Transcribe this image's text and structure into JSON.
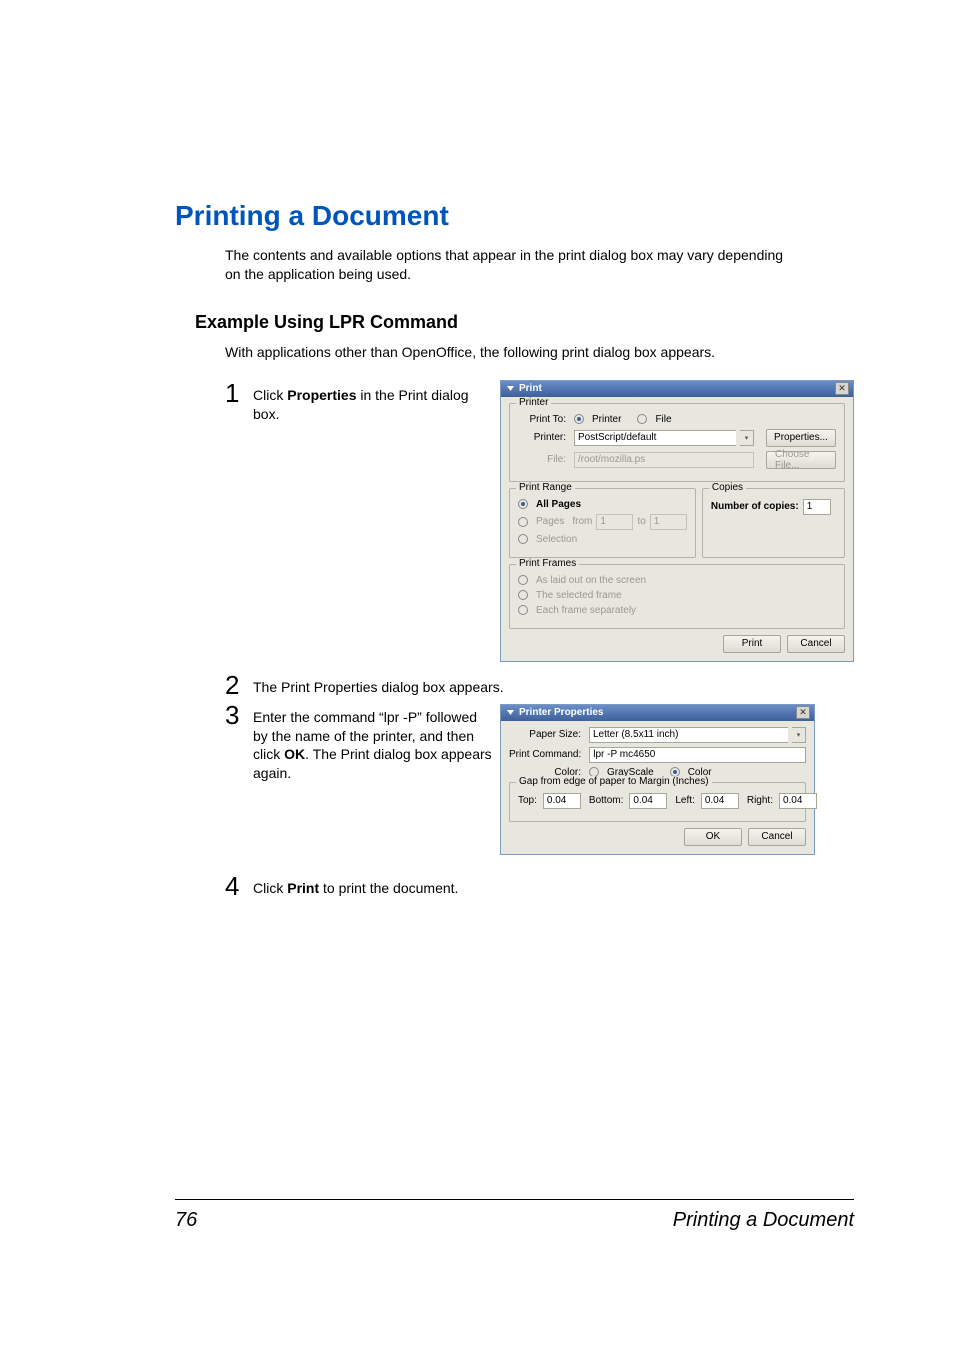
{
  "heading": "Printing a Document",
  "intro": "The contents and available options that appear in the print dialog box may vary depending on the application being used.",
  "subheading": "Example Using LPR Command",
  "subpara": "With applications other than OpenOffice, the following print dialog box appears.",
  "step1_num": "1",
  "step1_a": "Click ",
  "step1_b": "Properties",
  "step1_c": " in the Print dialog box.",
  "step2_num": "2",
  "step2_text": "The Print Properties dialog box appears.",
  "step3_num": "3",
  "step3_a": "Enter the command “lpr -P” followed by the name of the printer, and then click ",
  "step3_b": "OK",
  "step3_c": ". The Print dialog box appears again.",
  "step4_num": "4",
  "step4_a": "Click ",
  "step4_b": "Print",
  "step4_c": " to print the document.",
  "dlg1": {
    "title": "Print",
    "printer_group": "Printer",
    "print_to": "Print To:",
    "opt_printer": "Printer",
    "opt_file": "File",
    "printer_label": "Printer:",
    "printer_value": "PostScript/default",
    "properties_btn": "Properties...",
    "file_label": "File:",
    "file_value": "/root/mozilla.ps",
    "choose_btn": "Choose File...",
    "range_group": "Print Range",
    "all_pages": "All Pages",
    "pages": "Pages",
    "from": "from",
    "from_v": "1",
    "to": "to",
    "to_v": "1",
    "selection": "Selection",
    "copies_group": "Copies",
    "num_copies": "Number of copies:",
    "copies_v": "1",
    "frames_group": "Print Frames",
    "f1": "As laid out on the screen",
    "f2": "The selected frame",
    "f3": "Each frame separately",
    "print_btn": "Print",
    "cancel_btn": "Cancel"
  },
  "dlg2": {
    "title": "Printer Properties",
    "paper_size": "Paper Size:",
    "paper_v": "Letter (8.5x11 inch)",
    "print_cmd": "Print Command:",
    "cmd_v": "lpr -P mc4650",
    "color": "Color:",
    "gray": "GrayScale",
    "col": "Color",
    "gap_group": "Gap from edge of paper to Margin (Inches)",
    "top": "Top:",
    "bottom": "Bottom:",
    "left": "Left:",
    "right": "Right:",
    "v": "0.04",
    "ok": "OK",
    "cancel": "Cancel"
  },
  "footer_page": "76",
  "footer_text": "Printing a Document"
}
